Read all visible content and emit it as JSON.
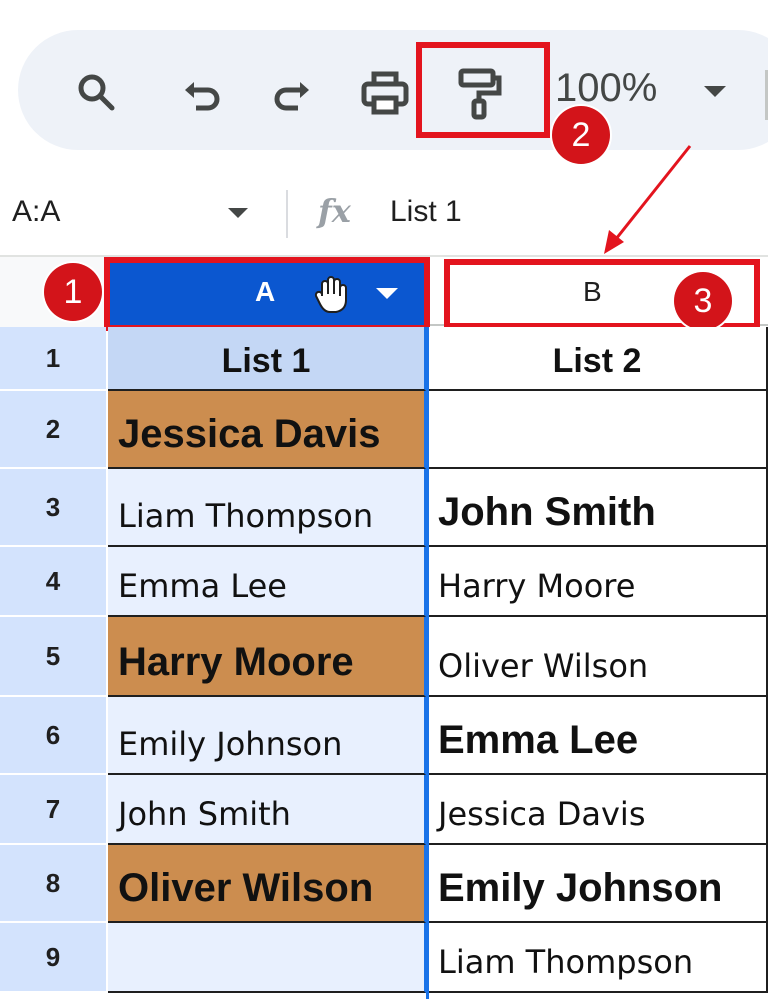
{
  "toolbar": {
    "zoom_value": "100%"
  },
  "formula_bar": {
    "name_box": "A:A",
    "fx_label": "fx",
    "value": "List 1"
  },
  "columns": [
    {
      "letter": "A"
    },
    {
      "letter": "B"
    }
  ],
  "annotations": {
    "badge1": "1",
    "badge2": "2",
    "badge3": "3",
    "accent_color": "#e3141e"
  },
  "rows": [
    {
      "num": "1",
      "a": "List 1",
      "b": "List 2"
    },
    {
      "num": "2",
      "a": "Jessica Davis",
      "b": ""
    },
    {
      "num": "3",
      "a": "Liam Thompson",
      "b": "John Smith"
    },
    {
      "num": "4",
      "a": "Emma Lee",
      "b": "Harry Moore"
    },
    {
      "num": "5",
      "a": "Harry Moore",
      "b": "Oliver Wilson"
    },
    {
      "num": "6",
      "a": "Emily Johnson",
      "b": "Emma Lee"
    },
    {
      "num": "7",
      "a": "John Smith",
      "b": "Jessica Davis"
    },
    {
      "num": "8",
      "a": "Oliver Wilson",
      "b": "Emily Johnson"
    },
    {
      "num": "9",
      "a": "",
      "b": "Liam Thompson"
    }
  ],
  "colors": {
    "selected_header": "#0b57d0",
    "highlight_fill": "#cc8d4f",
    "row_header": "#d3e3fd"
  }
}
